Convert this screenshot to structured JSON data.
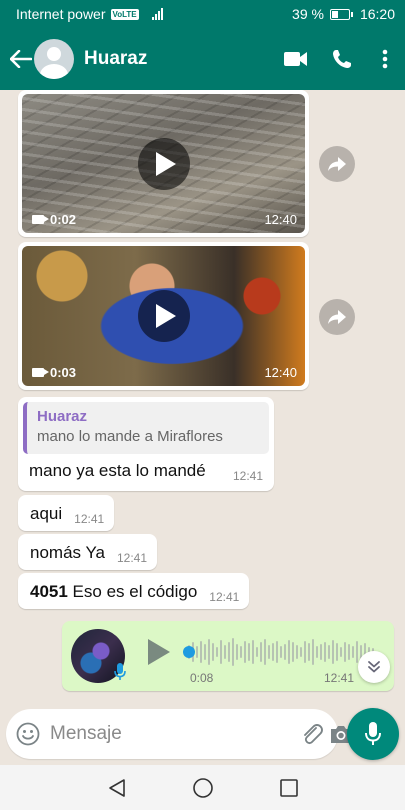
{
  "status_bar": {
    "carrier": "Internet power",
    "network_badge": "VoLTE",
    "battery_text": "39 %",
    "battery_level": 0.39,
    "time": "16:20"
  },
  "header": {
    "contact_name": "Huaraz",
    "icons": [
      "back-arrow-icon",
      "video-call-icon",
      "voice-call-icon",
      "more-options-icon"
    ]
  },
  "messages": {
    "video_1": {
      "duration": "0:02",
      "time": "12:40"
    },
    "video_2": {
      "duration": "0:03",
      "time": "12:40"
    },
    "reply": {
      "quoted_name": "Huaraz",
      "quoted_text": "mano lo mande a Miraflores",
      "text": "mano ya esta lo mandé",
      "time": "12:41"
    },
    "msg_aqui": {
      "text": "aqui",
      "time": "12:41"
    },
    "msg_nomas": {
      "text": "nomás Ya",
      "time": "12:41"
    },
    "msg_codigo": {
      "code": "4051",
      "text": " Eso es el código",
      "time": "12:41"
    },
    "voice_note": {
      "duration": "0:08",
      "time": "12:41"
    }
  },
  "input_bar": {
    "placeholder": "Mensaje"
  },
  "colors": {
    "header": "#00796b",
    "chat_background": "#ece5dd",
    "outgoing_bubble": "#dcf8c6",
    "send_button": "#00897b",
    "quote_accent": "#8e6dc4"
  }
}
